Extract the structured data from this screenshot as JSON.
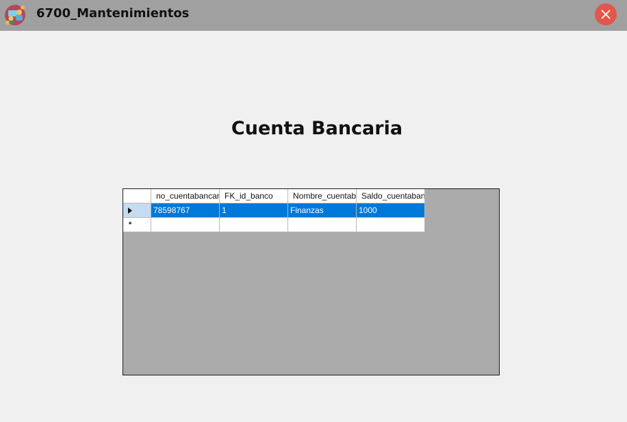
{
  "window": {
    "title": "6700_Mantenimientos",
    "app_icon": "bank-people-icon",
    "close_icon": "close-icon",
    "titlebar_color": "#a0a0a0",
    "close_color": "#e1574c"
  },
  "form": {
    "title": "Cuenta Bancaria"
  },
  "grid": {
    "columns": [
      "no_cuentabancaria",
      "FK_id_banco",
      "Nombre_cuentabanc",
      "Saldo_cuentabanca"
    ],
    "rows": [
      {
        "cells": [
          "78598767",
          "1",
          "Finanzas",
          "1000"
        ],
        "selected": true
      }
    ],
    "new_row_marker": "*",
    "selection_color": "#0078d7",
    "background_color": "#ababab"
  }
}
